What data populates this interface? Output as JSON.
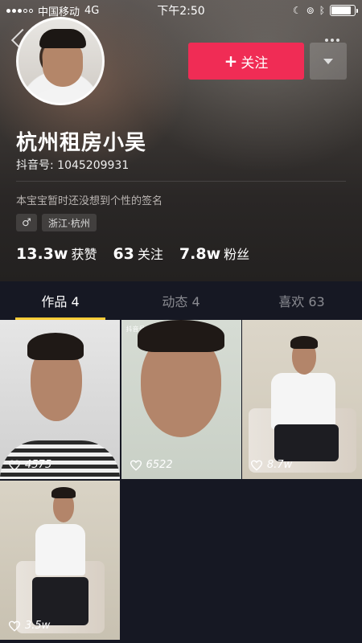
{
  "status_bar": {
    "carrier": "中国移动",
    "network": "4G",
    "time": "下午2:50",
    "battery_level": 0.85
  },
  "header": {
    "follow_button_label": "关注",
    "follow_button_plus": "+",
    "accent_color": "#f02c55"
  },
  "profile": {
    "name": "杭州租房小吴",
    "douyin_id_label": "抖音号: 1045209931",
    "bio": "本宝宝暂时还没想到个性的签名",
    "gender_symbol": "♂",
    "location": "浙江·杭州"
  },
  "stats": [
    {
      "value": "13.3w",
      "label": "获赞"
    },
    {
      "value": "63",
      "label": "关注"
    },
    {
      "value": "7.8w",
      "label": "粉丝"
    }
  ],
  "tabs": [
    {
      "label": "作品 4",
      "active": true
    },
    {
      "label": "动态 4",
      "active": false
    },
    {
      "label": "喜欢 63",
      "active": false
    }
  ],
  "tab_indicator_color": "#facc38",
  "videos": [
    {
      "likes": "4575"
    },
    {
      "likes": "6522",
      "watermark": "抖音号:1045209931"
    },
    {
      "likes": "8.7w"
    },
    {
      "likes": "3.5w"
    }
  ]
}
